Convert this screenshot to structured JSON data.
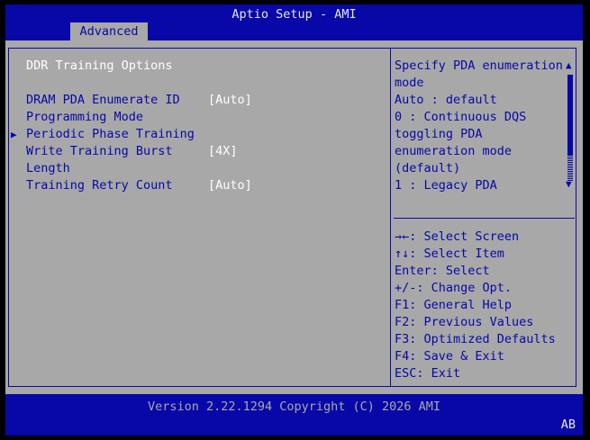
{
  "header": {
    "title": "Aptio Setup - AMI",
    "tab_label": "Advanced"
  },
  "page": {
    "heading": "DDR Training Options",
    "settings": [
      {
        "label_line1": "DRAM PDA Enumerate ID",
        "label_line2": "Programming Mode",
        "value": "[Auto]"
      },
      {
        "label_line1": "Periodic Phase Training"
      },
      {
        "label_line1": "Write Training Burst",
        "label_line2": "Length",
        "value": "[4X]"
      },
      {
        "label_line1": "Training Retry Count",
        "value": "[Auto]"
      }
    ]
  },
  "help": {
    "lines": [
      "Specify PDA enumeration",
      "mode",
      "Auto : default",
      "0 : Continuous DQS",
      "toggling PDA",
      "enumeration mode",
      "(default)",
      "1 : Legacy PDA"
    ],
    "scroll_up_glyph": "▲",
    "scroll_down_glyph": "▼"
  },
  "keys": [
    "→←: Select Screen",
    "↑↓: Select Item",
    "Enter: Select",
    "+/-: Change Opt.",
    "F1: General Help",
    "F2: Previous Values",
    "F3: Optimized Defaults",
    "F4: Save & Exit",
    "ESC: Exit"
  ],
  "footer": {
    "version": "Version 2.22.1294 Copyright (C) 2026 AMI",
    "badge": "AB"
  },
  "submenu_glyph": "▶",
  "colors": {
    "primary": "#0808a8",
    "panel": "#a8a8a8",
    "text_light": "#ffffff"
  }
}
